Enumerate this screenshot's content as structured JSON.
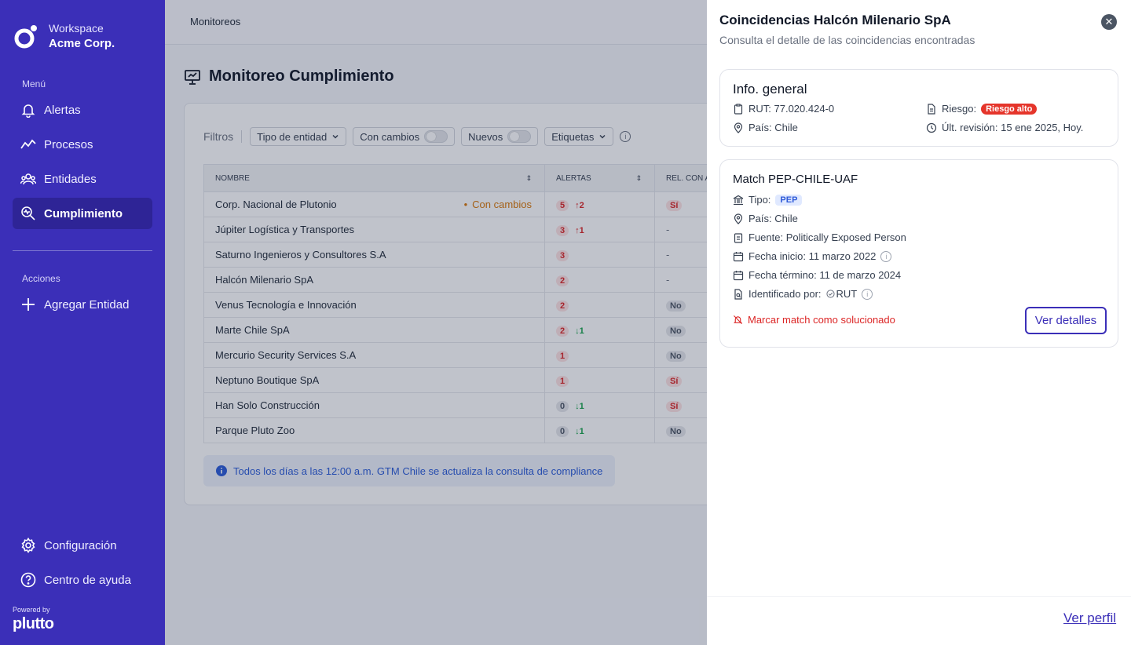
{
  "sidebar": {
    "workspace_label": "Workspace",
    "workspace_name": "Acme Corp.",
    "menu_label": "Menú",
    "items": [
      {
        "label": "Alertas",
        "icon": "bell-icon"
      },
      {
        "label": "Procesos",
        "icon": "trend-icon"
      },
      {
        "label": "Entidades",
        "icon": "users-icon"
      },
      {
        "label": "Cumplimiento",
        "icon": "compliance-icon",
        "active": true
      }
    ],
    "actions_label": "Acciones",
    "add_entity": "Agregar Entidad",
    "config": "Configuración",
    "help": "Centro de ayuda",
    "powered_by": "Powered by",
    "brand": "plutto"
  },
  "main": {
    "breadcrumb": "Monitoreos",
    "title": "Monitoreo Cumplimiento",
    "filters": {
      "label": "Filtros",
      "entity_type": "Tipo de entidad",
      "with_changes": "Con cambios",
      "new": "Nuevos",
      "tags": "Etiquetas"
    },
    "table": {
      "headers": {
        "name": "NOMBRE",
        "alerts": "ALERTAS",
        "rel": "REL. CON A"
      },
      "rows": [
        {
          "name": "Corp. Nacional de Plutonio",
          "changes": "Con cambios",
          "alerts": "5",
          "delta": "↑2",
          "delta_dir": "up",
          "rel": "Sí"
        },
        {
          "name": "Júpiter Logística y Transportes",
          "changes": "",
          "alerts": "3",
          "delta": "↑1",
          "delta_dir": "up",
          "rel": "-"
        },
        {
          "name": "Saturno Ingenieros y Consultores S.A",
          "changes": "",
          "alerts": "3",
          "delta": "",
          "delta_dir": "",
          "rel": "-"
        },
        {
          "name": "Halcón Milenario SpA",
          "changes": "",
          "alerts": "2",
          "delta": "",
          "delta_dir": "",
          "rel": "-"
        },
        {
          "name": "Venus Tecnología e Innovación",
          "changes": "",
          "alerts": "2",
          "delta": "",
          "delta_dir": "",
          "rel": "No"
        },
        {
          "name": "Marte Chile SpA",
          "changes": "",
          "alerts": "2",
          "delta": "↓1",
          "delta_dir": "down",
          "rel": "No"
        },
        {
          "name": "Mercurio Security Services S.A",
          "changes": "",
          "alerts": "1",
          "delta": "",
          "delta_dir": "",
          "rel": "No"
        },
        {
          "name": "Neptuno Boutique SpA",
          "changes": "",
          "alerts": "1",
          "delta": "",
          "delta_dir": "",
          "rel": "Sí"
        },
        {
          "name": "Han Solo Construcción",
          "changes": "",
          "alerts": "0",
          "delta": "↓1",
          "delta_dir": "down",
          "rel": "Sí"
        },
        {
          "name": "Parque Pluto Zoo",
          "changes": "",
          "alerts": "0",
          "delta": "↓1",
          "delta_dir": "down",
          "rel": "No"
        }
      ]
    },
    "notice": "Todos los días a las 12:00 a.m. GTM Chile se actualiza la consulta de compliance"
  },
  "panel": {
    "title": "Coincidencias Halcón Milenario SpA",
    "subtitle": "Consulta el detalle de las coincidencias encontradas",
    "general": {
      "title": "Info. general",
      "rut": "RUT: 77.020.424-0",
      "country": "País: Chile",
      "risk_label": "Riesgo:",
      "risk_value": "Riesgo alto",
      "last_review": "Últ. revisión: 15 ene 2025, Hoy."
    },
    "match": {
      "title": "Match PEP-CHILE-UAF",
      "type_label": "Tipo:",
      "type_value": "PEP",
      "country": "País: Chile",
      "source": "Fuente: Politically Exposed Person",
      "start": "Fecha inicio: 11 marzo 2022",
      "end": "Fecha término: 11 de marzo 2024",
      "identified_label": "Identificado por:",
      "identified_value": "RUT",
      "mark_solved": "Marcar match como solucionado",
      "details_button": "Ver detalles"
    },
    "profile_link": "Ver perfil"
  },
  "colors": {
    "sidebar": "#3b2fb8",
    "accent": "#3b2fb8",
    "danger": "#e5352b",
    "warning": "#d97706",
    "success": "#16a34a"
  }
}
